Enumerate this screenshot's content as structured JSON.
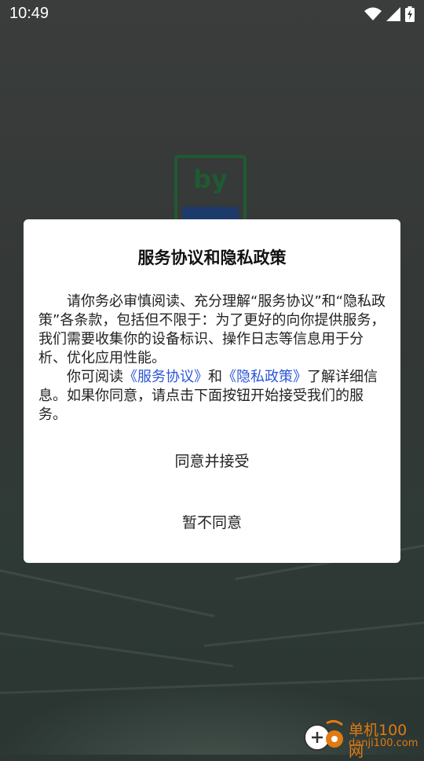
{
  "status_bar": {
    "time": "10:49",
    "icons": [
      "wifi-icon",
      "cell-signal-icon",
      "battery-charging-icon"
    ]
  },
  "dialog": {
    "title": "服务协议和隐私政策",
    "paragraph1": "请你务必审慎阅读、充分理解“服务协议”和“隐私政策”各条款，包括但不限于：为了更好的向你提供服务，我们需要收集你的设备标识、操作日志等信息用于分析、优化应用性能。",
    "paragraph2_prefix": "你可阅读",
    "link_service": "《服务协议》",
    "paragraph2_and": "和",
    "link_privacy": "《隐私政策》",
    "paragraph2_suffix": "了解详细信息。如果你同意，请点击下面按钮开始接受我们的服务。",
    "accept_label": "同意并接受",
    "decline_label": "暂不同意"
  },
  "watermark": {
    "line1": "单机100网",
    "line2": "danji100.com"
  },
  "colors": {
    "link": "#2a56d8",
    "logo_green": "#1f5a33",
    "logo_blue": "#1d3b6a",
    "watermark_orange": "#e07a12"
  }
}
